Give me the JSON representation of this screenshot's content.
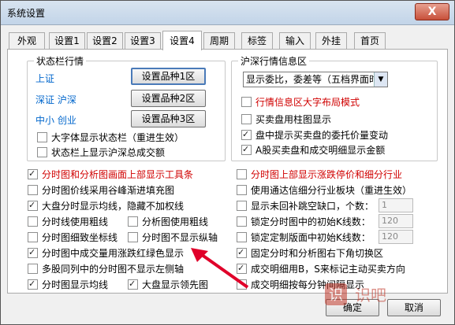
{
  "window": {
    "title": "系统设置",
    "close_label": "X"
  },
  "tabs": [
    "外观",
    "设置1",
    "设置2",
    "设置3",
    "设置4",
    "周期",
    "标签",
    "输入",
    "外挂",
    "首页"
  ],
  "active_tab": "设置4",
  "status_group": {
    "title": "状态栏行情",
    "rows": [
      {
        "label": "上证",
        "button": "设置品种1区"
      },
      {
        "label": "深证 沪深",
        "button": "设置品种2区"
      },
      {
        "label": "中小 创业",
        "button": "设置品种3区"
      }
    ],
    "checks": [
      {
        "label": "大字体显示状态栏（重进生效）",
        "checked": false
      },
      {
        "label": "状态栏上显示沪深总成交额",
        "checked": false
      }
    ]
  },
  "hs_group": {
    "title": "沪深行情信息区",
    "select_value": "显示委比，委差等（五档界面时）",
    "checks": [
      {
        "label": "行情信息区大字布局模式",
        "checked": false,
        "red": true
      },
      {
        "label": "买卖盘用柱图显示",
        "checked": false
      },
      {
        "label": "盘中提示买卖盘的委托价量变动",
        "checked": true
      },
      {
        "label": "A股买卖盘和成交明细显示金额",
        "checked": true
      }
    ]
  },
  "left_checks": [
    {
      "label": "分时图和分析图画面上部显示工具条",
      "checked": true,
      "red": true
    },
    {
      "label": "分时图价线采用谷峰渐进填充图",
      "checked": false
    },
    {
      "label": "大盘分时显示均线，隐藏不加权线",
      "checked": true
    },
    {
      "label": "分时线使用粗线",
      "checked": false
    },
    {
      "label": "分析图使用粗线",
      "checked": false
    },
    {
      "label": "分时图细致坐标线",
      "checked": false
    },
    {
      "label": "分时图不显示纵轴",
      "checked": false
    },
    {
      "label": "分时图中成交量用涨跌红绿色显示",
      "checked": true
    },
    {
      "label": "多股同列中的分时图不显示左侧轴",
      "checked": false
    },
    {
      "label": "分时图显示均线",
      "checked": true
    },
    {
      "label": "大盘显示领先图",
      "checked": true
    }
  ],
  "right_checks": [
    {
      "label": "分时图上部显示涨跌停价和细分行业",
      "checked": false,
      "red": true
    },
    {
      "label": "使用通达信细分行业板块（重进生效）",
      "checked": false
    },
    {
      "label": "显示未回补跳空缺口，个数：",
      "checked": false,
      "value": "1"
    },
    {
      "label": "锁定分时图中的初始K线数：",
      "checked": false,
      "value": "120"
    },
    {
      "label": "锁定定制版面中初始K线数：",
      "checked": false,
      "value": "120"
    },
    {
      "label": "固定分时和分析图右下角切换区",
      "checked": true
    },
    {
      "label": "成交明细用B，S来标记主动买卖方向",
      "checked": true
    },
    {
      "label": "成交明细按每分钟间隔显示",
      "checked": false
    }
  ],
  "footer": {
    "ok_label": "确定",
    "cancel_label": "取消",
    "watermark": "识吧"
  },
  "colors": {
    "red_text": "#d00000",
    "blue_text": "#0066cc",
    "annotation_arrow": "#e0002a"
  }
}
